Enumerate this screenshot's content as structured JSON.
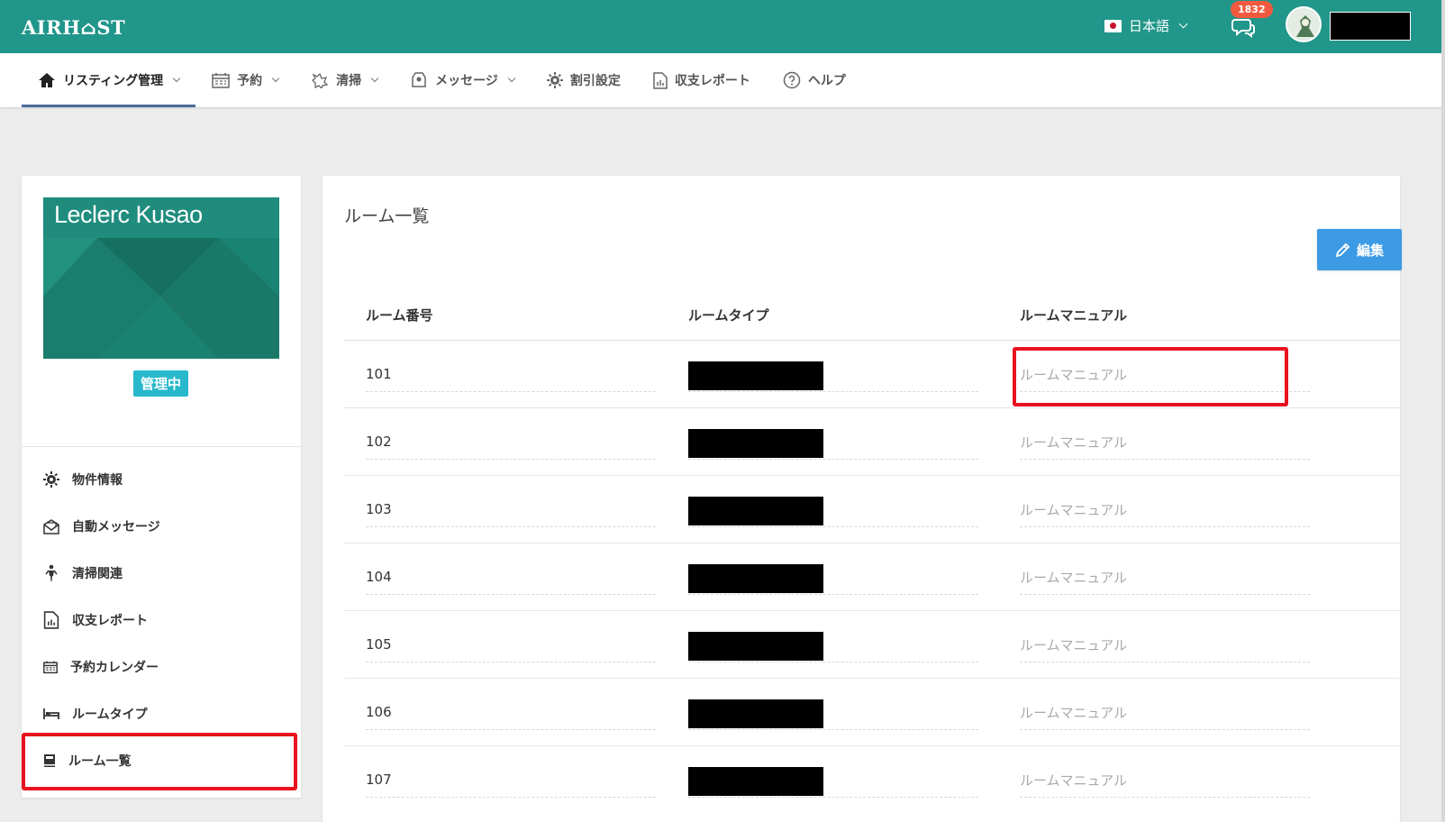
{
  "app": {
    "logo": "AIRH⌂ST",
    "language": "日本語",
    "notification_count": "1832",
    "brand_color": "#21968a"
  },
  "nav": {
    "items": [
      {
        "label": "リスティング管理",
        "icon": "home-icon",
        "dropdown": true,
        "active": true
      },
      {
        "label": "予約",
        "icon": "calendar-icon",
        "dropdown": true
      },
      {
        "label": "清掃",
        "icon": "cleaning-icon",
        "dropdown": true
      },
      {
        "label": "メッセージ",
        "icon": "message-icon",
        "dropdown": true
      },
      {
        "label": "割引設定",
        "icon": "gear-icon",
        "dropdown": false
      },
      {
        "label": "収支レポート",
        "icon": "report-icon",
        "dropdown": false
      },
      {
        "label": "ヘルプ",
        "icon": "help-icon",
        "dropdown": false
      }
    ]
  },
  "property": {
    "name": "Leclerc Kusao",
    "status": "管理中"
  },
  "sidebar": {
    "items": [
      {
        "label": "物件情報",
        "icon": "gear-icon"
      },
      {
        "label": "自動メッセージ",
        "icon": "envelope-icon"
      },
      {
        "label": "清掃関連",
        "icon": "person-icon"
      },
      {
        "label": "収支レポート",
        "icon": "report-icon"
      },
      {
        "label": "予約カレンダー",
        "icon": "calendar-icon"
      },
      {
        "label": "ルームタイプ",
        "icon": "bed-icon"
      },
      {
        "label": "ルーム一覧",
        "icon": "book-icon",
        "highlighted": true
      }
    ]
  },
  "main": {
    "title": "ルーム一覧",
    "edit_label": "編集",
    "columns": [
      "ルーム番号",
      "ルームタイプ",
      "ルームマニュアル"
    ],
    "rows": [
      {
        "number": "101",
        "manual": "ルームマニュアル"
      },
      {
        "number": "102",
        "manual": "ルームマニュアル"
      },
      {
        "number": "103",
        "manual": "ルームマニュアル"
      },
      {
        "number": "104",
        "manual": "ルームマニュアル"
      },
      {
        "number": "105",
        "manual": "ルームマニュアル"
      },
      {
        "number": "106",
        "manual": "ルームマニュアル"
      },
      {
        "number": "107",
        "manual": "ルームマニュアル"
      }
    ]
  }
}
